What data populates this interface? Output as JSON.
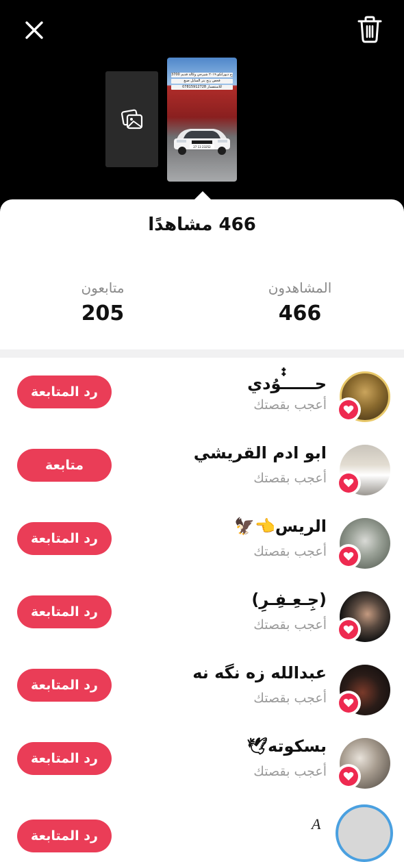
{
  "header": {
    "close_icon": "close-icon",
    "delete_icon": "trash-icon",
    "placeholder_icon": "image-placeholder-icon",
    "story_lines": [
      "دوج ديورانكو ٢٠١٩ شيرجي وكالة فديم 3700 RT",
      "فحص رنج بنر السايل صبغ",
      "07815912728 للاستفسار"
    ],
    "plate_text": "27 13 23252"
  },
  "summary": {
    "total_views_label": "466 مشاهدًا",
    "viewers_label": "المشاهدون",
    "viewers_value": "466",
    "followers_label": "متابعون",
    "followers_value": "205"
  },
  "viewers": [
    {
      "name": "حـــــ๋๋ـوُدي",
      "action": "أعجب بقصتك",
      "button": "رد المتابعة"
    },
    {
      "name": "ابو ادم القريشي",
      "action": "أعجب بقصتك",
      "button": "متابعة"
    },
    {
      "name": "الريس👈🦅",
      "action": "أعجب بقصتك",
      "button": "رد المتابعة"
    },
    {
      "name": "(جِـعِـفِـرِ)",
      "action": "أعجب بقصتك",
      "button": "رد المتابعة"
    },
    {
      "name": "عبدالله زه نگه نه",
      "action": "أعجب بقصتك",
      "button": "رد المتابعة"
    },
    {
      "name": "بسكوته🕊",
      "action": "أعجب بقصتك",
      "button": "رد المتابعة"
    }
  ],
  "partial_row": {
    "name_glyph": "A",
    "button": "رد المتابعة"
  },
  "colors": {
    "accent": "#ea3d57",
    "heart": "#ee2a50",
    "muted": "#9a9a9a"
  }
}
